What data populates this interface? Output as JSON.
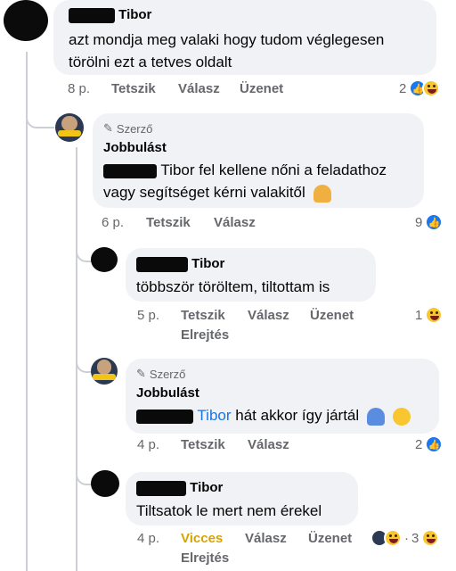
{
  "comments": [
    {
      "id": "c1",
      "name": "Tibor",
      "text": "azt  mondja meg valaki hogy tudom véglegesen törölni ezt a tetves oldalt",
      "time": "8 p.",
      "actions": [
        "Tetszik",
        "Válasz",
        "Üzenet"
      ],
      "reaction_count": "2",
      "reaction_types": [
        "like-icon",
        "haha-icon"
      ]
    },
    {
      "id": "c2",
      "author_badge": "Szerző",
      "name": "Jobbulást",
      "text": "Tibor fel kellene nőni a feladathoz vagy segítséget kérni valakitől",
      "time": "6 p.",
      "actions": [
        "Tetszik",
        "Válasz"
      ],
      "reaction_count": "9",
      "reaction_types": [
        "like-icon"
      ]
    },
    {
      "id": "c3",
      "name": "Tibor",
      "text": "többször töröltem,  tiltottam is",
      "time": "5 p.",
      "actions": [
        "Tetszik",
        "Válasz",
        "Üzenet"
      ],
      "extra_action": "Elrejtés",
      "reaction_count": "1",
      "reaction_types": [
        "haha-icon"
      ]
    },
    {
      "id": "c4",
      "author_badge": "Szerző",
      "name": "Jobbulást",
      "mention": "Tibor",
      "text": "hát akkor így jártál",
      "time": "4 p.",
      "actions": [
        "Tetszik",
        "Válasz"
      ],
      "reaction_count": "2",
      "reaction_types": [
        "like-icon"
      ]
    },
    {
      "id": "c5",
      "name": "Tibor",
      "text": "Tiltsatok le mert nem érekel",
      "time": "4 p.",
      "actions": [
        "Vicces",
        "Válasz",
        "Üzenet"
      ],
      "extra_action": "Elrejtés",
      "reaction_count": "3",
      "reaction_types": [
        "profile-reaction-icon",
        "haha-icon"
      ]
    }
  ],
  "colors": {
    "bubble": "#f0f2f5",
    "secondary_text": "#65676b",
    "link_blue": "#1b74e4",
    "like_blue": "#1877f2",
    "vicces_yellow": "#d7a300",
    "thread_line": "#ccd0d5"
  }
}
